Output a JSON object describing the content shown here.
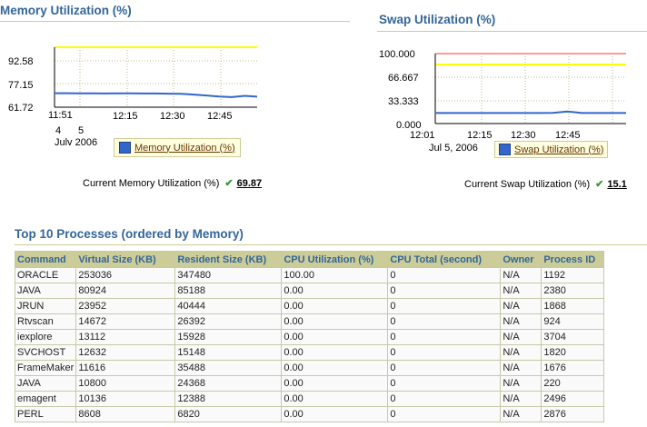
{
  "memory": {
    "title": "Memory Utilization (%)",
    "y_ticks": [
      "92.58",
      "77.15",
      "61.72"
    ],
    "x_ticks": [
      "11:51",
      "12:15",
      "12:30",
      "12:45"
    ],
    "x_sub": [
      "4",
      "5"
    ],
    "date_label": "July 2006",
    "legend": "Memory Utilization (%)",
    "current_label": "Current Memory Utilization (%)",
    "current_value": "69.87"
  },
  "swap": {
    "title": "Swap Utilization (%)",
    "y_ticks": [
      "100.000",
      "66.667",
      "33.333",
      "0.000"
    ],
    "x_ticks": [
      "12:01",
      "12:15",
      "12:30",
      "12:45"
    ],
    "date_label": "Jul 5, 2006",
    "legend": "Swap Utilization (%)",
    "current_label": "Current Swap Utilization (%)",
    "current_value": "15.1"
  },
  "processes": {
    "title": "Top 10 Processes (ordered by Memory)",
    "columns": [
      "Command",
      "Virtual Size (KB)",
      "Resident Size (KB)",
      "CPU Utilization (%)",
      "CPU Total (second)",
      "Owner",
      "Process ID"
    ],
    "rows": [
      [
        "ORACLE",
        "253036",
        "347480",
        "100.00",
        "0",
        "N/A",
        "1192"
      ],
      [
        "JAVA",
        "80924",
        "85188",
        "0.00",
        "0",
        "N/A",
        "2380"
      ],
      [
        "JRUN",
        "23952",
        "40444",
        "0.00",
        "0",
        "N/A",
        "1868"
      ],
      [
        "Rtvscan",
        "14672",
        "26392",
        "0.00",
        "0",
        "N/A",
        "924"
      ],
      [
        "iexplore",
        "13112",
        "15928",
        "0.00",
        "0",
        "N/A",
        "3704"
      ],
      [
        "SVCHOST",
        "12632",
        "15148",
        "0.00",
        "0",
        "N/A",
        "1820"
      ],
      [
        "FrameMaker",
        "11616",
        "35488",
        "0.00",
        "0",
        "N/A",
        "1676"
      ],
      [
        "JAVA",
        "10800",
        "24368",
        "0.00",
        "0",
        "N/A",
        "220"
      ],
      [
        "emagent",
        "10136",
        "12388",
        "0.00",
        "0",
        "N/A",
        "2496"
      ],
      [
        "PERL",
        "8608",
        "6820",
        "0.00",
        "0",
        "N/A",
        "2876"
      ]
    ]
  },
  "chart_data": [
    {
      "type": "line",
      "title": "Memory Utilization (%)",
      "ylim": [
        61.72,
        108.0
      ],
      "threshold": 108.0,
      "series": [
        {
          "name": "Memory Utilization (%)",
          "values": [
            72.5,
            72.5,
            72.4,
            72.4,
            72.3,
            72.4,
            72.4,
            72.3,
            72.3,
            72.2,
            72.0,
            71.5,
            70.8,
            70.0,
            69.5,
            70.5,
            69.87
          ]
        }
      ],
      "colors": {
        "line": "#3366cc",
        "threshold": "#ffff00"
      }
    },
    {
      "type": "line",
      "title": "Swap Utilization (%)",
      "ylim": [
        0,
        100
      ],
      "thresholds": [
        100,
        95,
        85
      ],
      "series": [
        {
          "name": "Swap Utilization (%)",
          "values": [
            15.1,
            15.1,
            15.1,
            15.1,
            15.1,
            15.1,
            15.1,
            15.1,
            15.2,
            17.3,
            15.1,
            15.1,
            15.1,
            15.1
          ]
        }
      ],
      "colors": {
        "line": "#3366cc",
        "critical": "#ff9999",
        "warning": "#ffff00"
      }
    }
  ]
}
